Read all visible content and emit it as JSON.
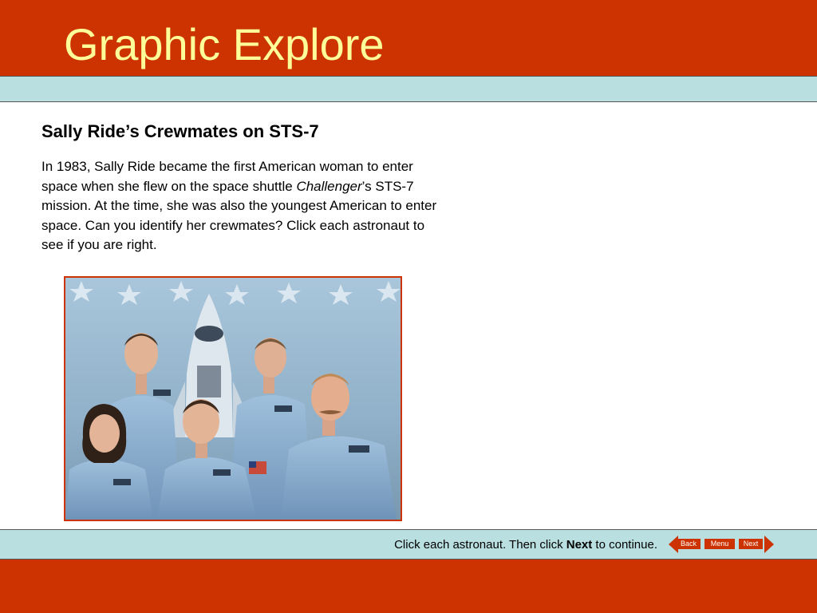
{
  "header": {
    "title": "Graphic Explore"
  },
  "main": {
    "heading": "Sally Ride’s Crewmates on STS-7",
    "paragraph_part1": "In 1983, Sally Ride became the first American woman to enter space when she flew on the space shuttle ",
    "paragraph_italic": "Challenger",
    "paragraph_part2": "’s STS-7 mission. At the time, she was also the youngest American to enter space. Can you identify her crewmates? Click each astronaut to see if you are right."
  },
  "footer": {
    "instruction_pre": "Click each astronaut. Then click ",
    "instruction_bold": "Next",
    "instruction_post": " to continue.",
    "nav": {
      "back": "Back",
      "menu": "Menu",
      "next": "Next"
    }
  },
  "colors": {
    "primary": "#cc3300",
    "accent_band": "#b9dfe0",
    "title": "#ffff99"
  }
}
